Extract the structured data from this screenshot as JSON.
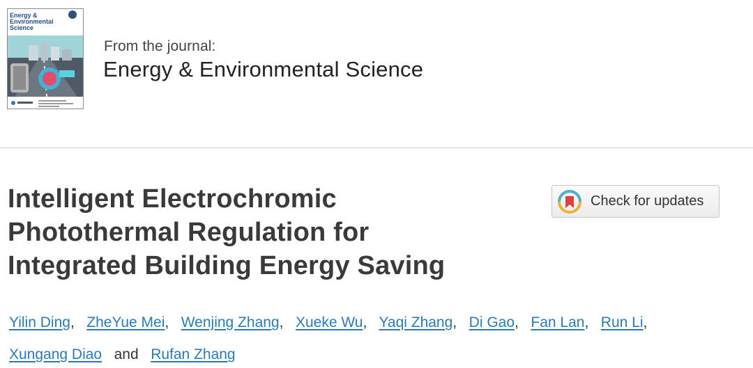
{
  "journal": {
    "from_label": "From the journal:",
    "name": "Energy & Environmental Science",
    "cover_title": [
      "Energy &",
      "Environmental",
      "Science"
    ]
  },
  "article": {
    "title_lines": [
      "Intelligent Electrochromic",
      "Photothermal Regulation for",
      "Integrated Building Energy Saving"
    ]
  },
  "updates_button": {
    "label": "Check for updates",
    "icon": "crossmark-icon"
  },
  "authors": [
    "Yilin Ding",
    "ZheYue Mei",
    "Wenjing Zhang",
    "Xueke Wu",
    "Yaqi Zhang",
    "Di Gao",
    "Fan Lan",
    "Run Li",
    "Xungang Diao",
    "Rufan Zhang"
  ],
  "author_separator": ",",
  "author_conjunction": "and",
  "colors": {
    "link": "#2a7ab8",
    "title": "#3a3a3a",
    "divider": "#d9d9d9"
  }
}
